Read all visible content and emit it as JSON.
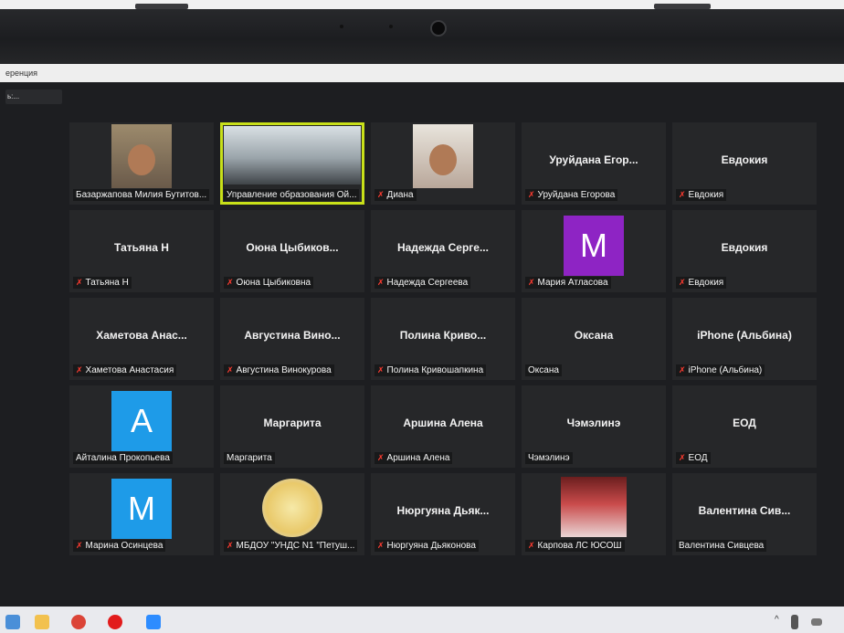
{
  "window": {
    "title": "еренция"
  },
  "topbar": {
    "info_label": "ь:..."
  },
  "colors": {
    "active_speaker_border": "#c8e019",
    "muted_mic": "#ff3b30",
    "avatar_bg_purple": "#8e24c4",
    "avatar_bg_blue": "#1e9be8"
  },
  "participants": [
    {
      "display": "",
      "label": "Базаржапова Милия Бутитов...",
      "muted": false,
      "kind": "video"
    },
    {
      "display": "",
      "label": "Управление образования Ой...",
      "muted": false,
      "kind": "room",
      "active": true
    },
    {
      "display": "",
      "label": "Диана",
      "muted": true,
      "kind": "video"
    },
    {
      "display": "Уруйдана Егор...",
      "label": "Уруйдана Егорова",
      "muted": true,
      "kind": "name"
    },
    {
      "display": "Евдокия",
      "label": "Евдокия",
      "muted": true,
      "kind": "name"
    },
    {
      "display": "Татьяна Н",
      "label": "Татьяна Н",
      "muted": true,
      "kind": "name"
    },
    {
      "display": "Оюна Цыбиков...",
      "label": "Оюна Цыбиковна",
      "muted": true,
      "kind": "name"
    },
    {
      "display": "Надежда Серге...",
      "label": "Надежда Сергеева",
      "muted": true,
      "kind": "name"
    },
    {
      "display": "M",
      "label": "Мария Атласова",
      "muted": true,
      "kind": "avatar",
      "color": "purple"
    },
    {
      "display": "Евдокия",
      "label": "Евдокия",
      "muted": true,
      "kind": "name"
    },
    {
      "display": "Хаметова Анас...",
      "label": "Хаметова Анастасия",
      "muted": true,
      "kind": "name"
    },
    {
      "display": "Августина Вино...",
      "label": "Августина Винокурова",
      "muted": true,
      "kind": "name"
    },
    {
      "display": "Полина Криво...",
      "label": "Полина Кривошапкина",
      "muted": true,
      "kind": "name"
    },
    {
      "display": "Оксана",
      "label": "Оксана",
      "muted": false,
      "kind": "name"
    },
    {
      "display": "iPhone (Альбина)",
      "label": "iPhone (Альбина)",
      "muted": true,
      "kind": "name"
    },
    {
      "display": "A",
      "label": "Айталина Прокопьева",
      "muted": false,
      "kind": "avatar",
      "color": "blue"
    },
    {
      "display": "Маргарита",
      "label": "Маргарита",
      "muted": false,
      "kind": "name"
    },
    {
      "display": "Аршина Алена",
      "label": "Аршина Алена",
      "muted": true,
      "kind": "name"
    },
    {
      "display": "Чэмэлинэ",
      "label": "Чэмэлинэ",
      "muted": false,
      "kind": "name"
    },
    {
      "display": "ЕОД",
      "label": "ЕОД",
      "muted": true,
      "kind": "name"
    },
    {
      "display": "M",
      "label": "Марина Осинцева",
      "muted": true,
      "kind": "avatar",
      "color": "blue"
    },
    {
      "display": "",
      "label": "МБДОУ \"УНДС N1 \"Петуш...",
      "muted": true,
      "kind": "logo"
    },
    {
      "display": "Нюргуяна Дьяк...",
      "label": "Нюргуяна Дьяконова",
      "muted": true,
      "kind": "name"
    },
    {
      "display": "",
      "label": "Карпова ЛС ЮСОШ",
      "muted": true,
      "kind": "photo"
    },
    {
      "display": "Валентина Сив...",
      "label": "Валентина Сивцева",
      "muted": false,
      "kind": "name"
    }
  ]
}
